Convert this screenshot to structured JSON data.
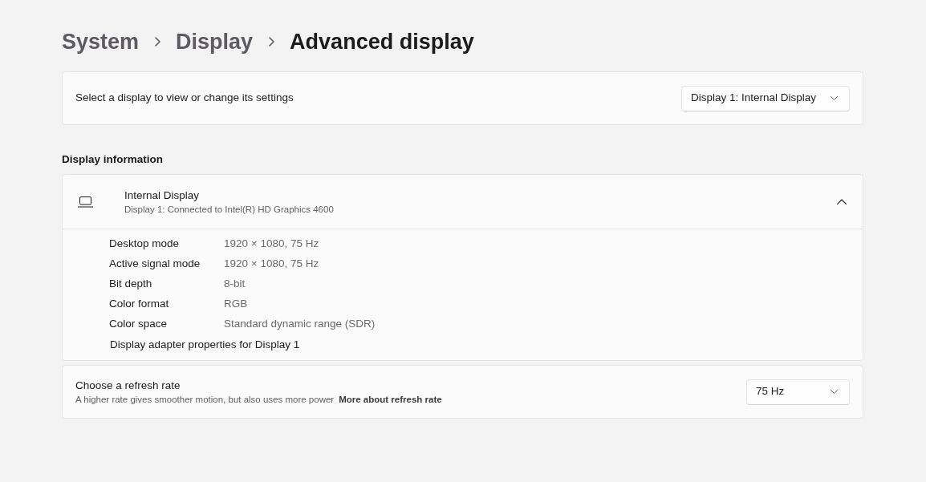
{
  "breadcrumb": [
    {
      "label": "System",
      "current": false
    },
    {
      "label": "Display",
      "current": false
    },
    {
      "label": "Advanced display",
      "current": true
    }
  ],
  "display_selector": {
    "label": "Select a display to view or change its settings",
    "dropdown": {
      "value": "Display 1: Internal Display"
    }
  },
  "display_information": {
    "heading": "Display information",
    "display": {
      "name": "Internal Display",
      "detail": "Display 1: Connected to Intel(R) HD Graphics 4600",
      "expanded": true
    },
    "properties": [
      {
        "label": "Desktop mode",
        "value": "1920 × 1080, 75 Hz"
      },
      {
        "label": "Active signal mode",
        "value": "1920 × 1080, 75 Hz"
      },
      {
        "label": "Bit depth",
        "value": "8-bit"
      },
      {
        "label": "Color format",
        "value": "RGB"
      },
      {
        "label": "Color space",
        "value": "Standard dynamic range (SDR)"
      }
    ],
    "adapter_link": "Display adapter properties for Display 1"
  },
  "refresh_rate": {
    "title": "Choose a refresh rate",
    "description": "A higher rate gives smoother motion, but also uses more power",
    "link": "More about refresh rate",
    "dropdown": {
      "value": "75 Hz"
    }
  }
}
